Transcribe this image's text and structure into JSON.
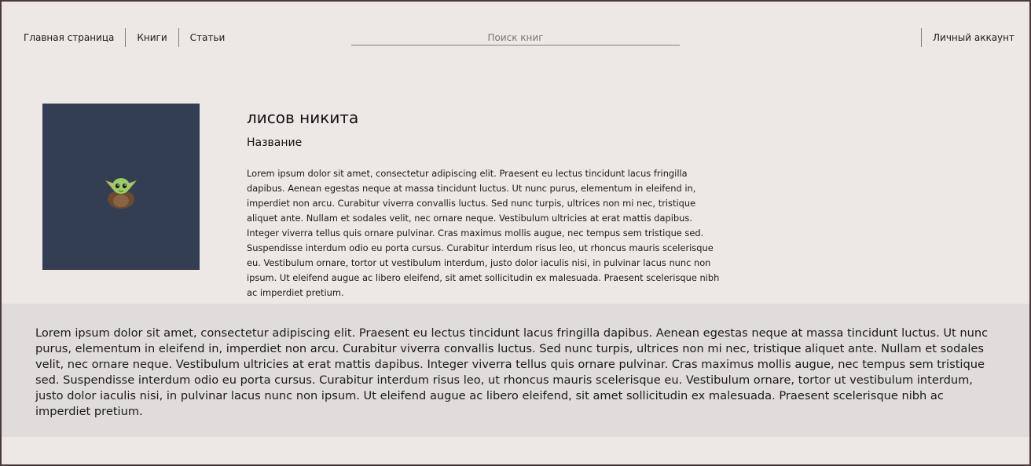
{
  "header": {
    "nav": [
      {
        "label": "Главная страница"
      },
      {
        "label": "Книги"
      },
      {
        "label": "Статьи"
      }
    ],
    "search_placeholder": "Поиск книг",
    "account_label": "Личный аккаунт"
  },
  "book": {
    "cover_icon": "baby-yoda-icon",
    "author": "лисов никита",
    "title": "Название",
    "description": "Lorem ipsum dolor sit amet, consectetur adipiscing elit. Praesent eu lectus tincidunt lacus fringilla dapibus. Aenean egestas neque at massa tincidunt luctus. Ut nunc purus, elementum in eleifend in, imperdiet non arcu. Curabitur viverra convallis luctus. Sed nunc turpis, ultrices non mi nec, tristique aliquet ante. Nullam et sodales velit, nec ornare neque. Vestibulum ultricies at erat mattis dapibus. Integer viverra tellus quis ornare pulvinar. Cras maximus mollis augue, nec tempus sem tristique sed. Suspendisse interdum odio eu porta cursus. Curabitur interdum risus leo, ut rhoncus mauris scelerisque eu. Vestibulum ornare, tortor ut vestibulum interdum, justo dolor iaculis nisi, in pulvinar lacus nunc non ipsum. Ut eleifend augue ac libero eleifend, sit amet sollicitudin ex malesuada. Praesent scelerisque nibh ac imperdiet pretium."
  },
  "details": {
    "text": "Lorem ipsum dolor sit amet, consectetur adipiscing elit. Praesent eu lectus tincidunt lacus fringilla dapibus. Aenean egestas neque at massa tincidunt luctus. Ut nunc purus, elementum in eleifend in, imperdiet non arcu. Curabitur viverra convallis luctus. Sed nunc turpis, ultrices non mi nec, tristique aliquet ante. Nullam et sodales velit, nec ornare neque. Vestibulum ultricies at erat mattis dapibus. Integer viverra tellus quis ornare pulvinar. Cras maximus mollis augue, nec tempus sem tristique sed. Suspendisse interdum odio eu porta cursus. Curabitur interdum risus leo, ut rhoncus mauris scelerisque eu. Vestibulum ornare, tortor ut vestibulum interdum, justo dolor iaculis nisi, in pulvinar lacus nunc non ipsum. Ut eleifend augue ac libero eleifend, sit amet sollicitudin ex malesuada. Praesent scelerisque nibh ac imperdiet pretium."
  },
  "colors": {
    "page_background": "#ede8e6",
    "border": "#4a3a3a",
    "cover_background": "#333e52",
    "band_background": "#dfdcdb"
  }
}
